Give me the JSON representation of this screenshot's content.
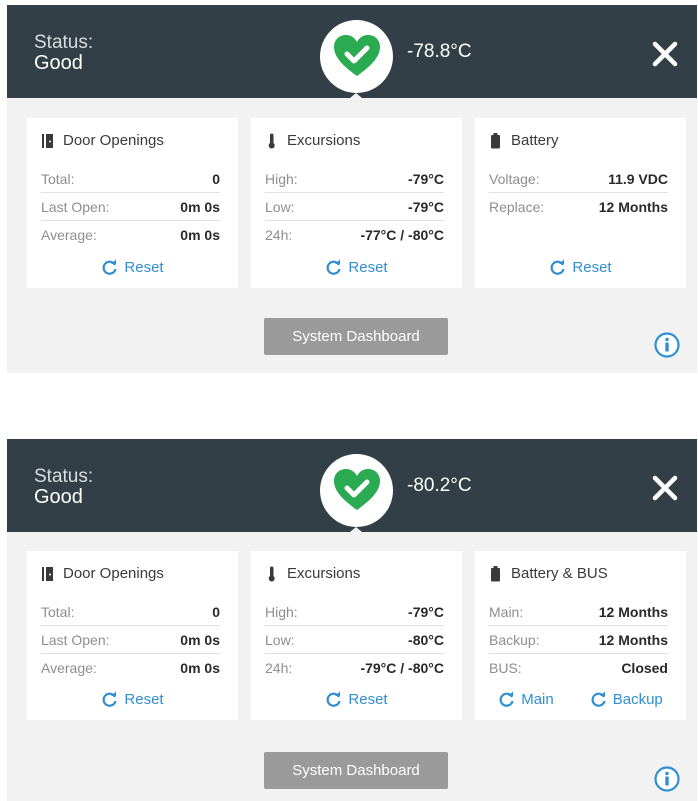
{
  "colors": {
    "header": "#323f47",
    "accent_green": "#2bab51",
    "link_blue": "#2f8fd1",
    "button_gray": "#9a9a9a"
  },
  "panels": [
    {
      "status_label": "Status:",
      "status_value": "Good",
      "temperature": "-78.8°C",
      "cards": [
        {
          "title": "Door Openings",
          "icon": "door-icon",
          "rows": [
            {
              "k": "Total:",
              "v": "0"
            },
            {
              "k": "Last Open:",
              "v": "0m 0s"
            },
            {
              "k": "Average:",
              "v": "0m 0s"
            }
          ],
          "actions": [
            "Reset"
          ]
        },
        {
          "title": "Excursions",
          "icon": "thermometer-icon",
          "rows": [
            {
              "k": "High:",
              "v": "-79°C"
            },
            {
              "k": "Low:",
              "v": "-79°C"
            },
            {
              "k": "24h:",
              "v": "-77°C / -80°C"
            }
          ],
          "actions": [
            "Reset"
          ]
        },
        {
          "title": "Battery",
          "icon": "battery-icon",
          "rows": [
            {
              "k": "Voltage:",
              "v": "11.9 VDC"
            },
            {
              "k": "Replace:",
              "v": "12 Months"
            }
          ],
          "actions": [
            "Reset"
          ]
        }
      ],
      "dashboard_label": "System Dashboard"
    },
    {
      "status_label": "Status:",
      "status_value": "Good",
      "temperature": "-80.2°C",
      "cards": [
        {
          "title": "Door Openings",
          "icon": "door-icon",
          "rows": [
            {
              "k": "Total:",
              "v": "0"
            },
            {
              "k": "Last Open:",
              "v": "0m 0s"
            },
            {
              "k": "Average:",
              "v": "0m 0s"
            }
          ],
          "actions": [
            "Reset"
          ]
        },
        {
          "title": "Excursions",
          "icon": "thermometer-icon",
          "rows": [
            {
              "k": "High:",
              "v": "-79°C"
            },
            {
              "k": "Low:",
              "v": "-80°C"
            },
            {
              "k": "24h:",
              "v": "-79°C / -80°C"
            }
          ],
          "actions": [
            "Reset"
          ]
        },
        {
          "title": "Battery & BUS",
          "icon": "battery-icon",
          "rows": [
            {
              "k": "Main:",
              "v": "12 Months"
            },
            {
              "k": "Backup:",
              "v": "12 Months"
            },
            {
              "k": "BUS:",
              "v": "Closed"
            }
          ],
          "actions": [
            "Main",
            "Backup"
          ]
        }
      ],
      "dashboard_label": "System Dashboard"
    }
  ]
}
